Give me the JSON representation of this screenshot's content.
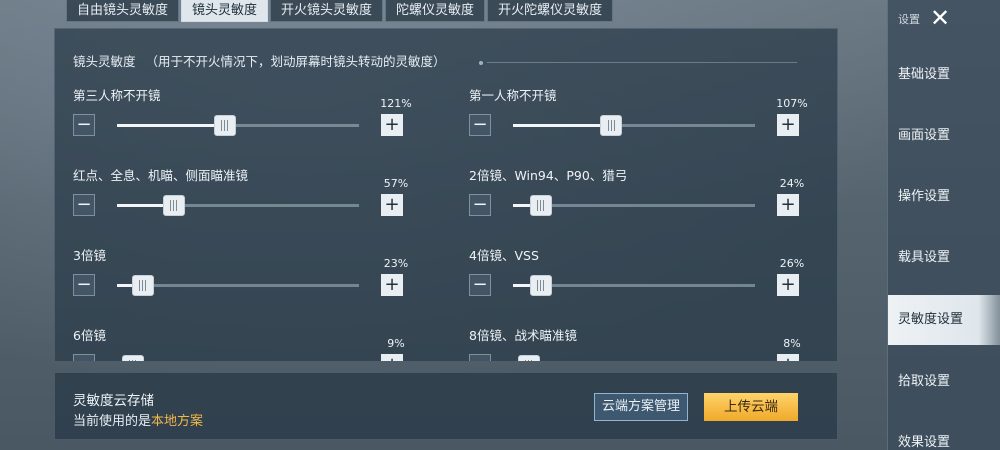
{
  "tabs": [
    {
      "label": "自由镜头灵敏度",
      "active": false
    },
    {
      "label": "镜头灵敏度",
      "active": true
    },
    {
      "label": "开火镜头灵敏度",
      "active": false
    },
    {
      "label": "陀螺仪灵敏度",
      "active": false
    },
    {
      "label": "开火陀螺仪灵敏度",
      "active": false
    }
  ],
  "section": {
    "title": "镜头灵敏度",
    "note": "（用于不开火情况下，划动屏幕时镜头转动的灵敏度）"
  },
  "settings": [
    {
      "label": "第三人称不开镜",
      "value": "121%",
      "level": 0.4
    },
    {
      "label": "第一人称不开镜",
      "value": "107%",
      "level": 0.36
    },
    {
      "label": "红点、全息、机瞄、侧面瞄准镜",
      "value": "57%",
      "level": 0.19
    },
    {
      "label": "2倍镜、Win94、P90、猎弓",
      "value": "24%",
      "level": 0.07
    },
    {
      "label": "3倍镜",
      "value": "23%",
      "level": 0.06
    },
    {
      "label": "4倍镜、VSS",
      "value": "26%",
      "level": 0.07
    },
    {
      "label": "6倍镜",
      "value": "9%",
      "level": 0.02
    },
    {
      "label": "8倍镜、战术瞄准镜",
      "value": "8%",
      "level": 0.02
    }
  ],
  "stepper": {
    "minus": "−",
    "plus": "+"
  },
  "cloud": {
    "title": "灵敏度云存储",
    "current_prefix": "当前使用的是",
    "current_value": "本地方案",
    "manage_label": "云端方案管理",
    "upload_label": "上传云端"
  },
  "sidebar": {
    "header": "设置",
    "close_icon": "close-icon",
    "items": [
      {
        "label": "基础设置",
        "active": false
      },
      {
        "label": "画面设置",
        "active": false
      },
      {
        "label": "操作设置",
        "active": false
      },
      {
        "label": "载具设置",
        "active": false
      },
      {
        "label": "灵敏度设置",
        "active": true
      },
      {
        "label": "拾取设置",
        "active": false
      },
      {
        "label": "效果设置",
        "active": false
      }
    ]
  },
  "colors": {
    "accent": "#f1b84a",
    "upload": "#f5b43a",
    "manage_border": "#8fb5d4"
  }
}
